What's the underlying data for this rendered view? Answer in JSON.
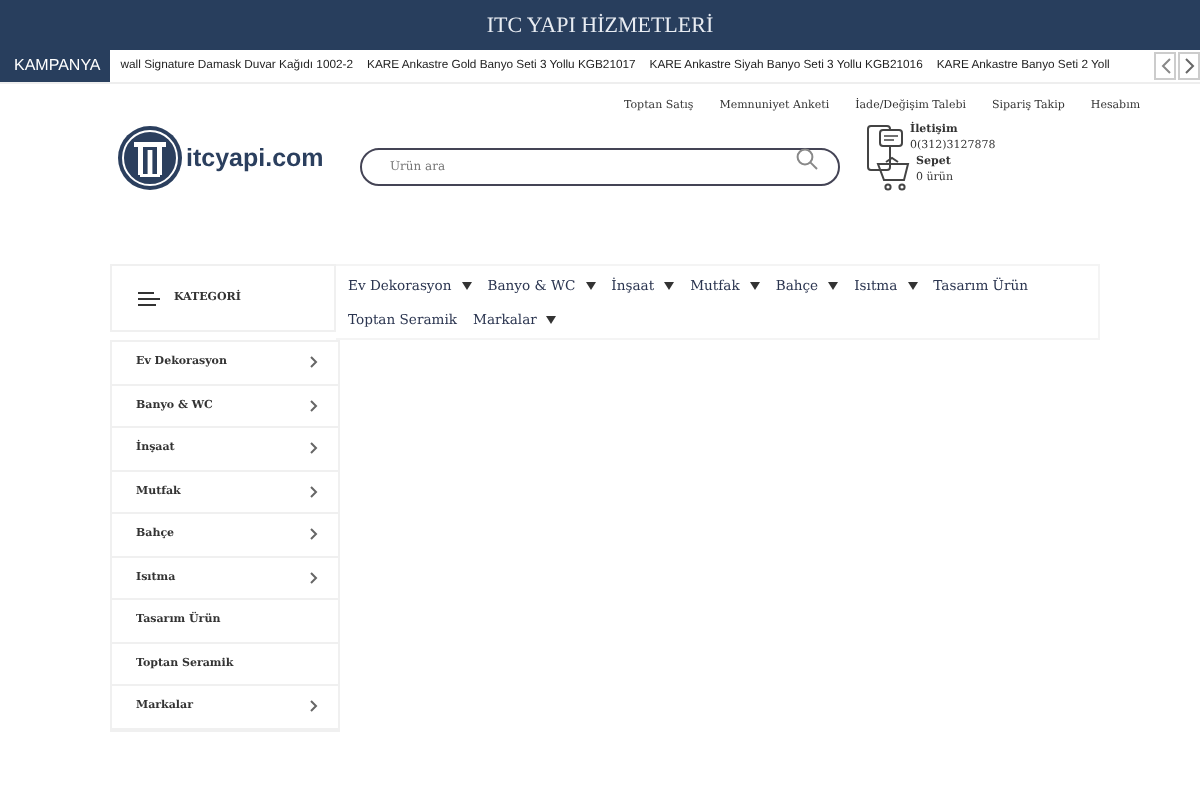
{
  "top_banner": {
    "title": "ITC YAPI HİZMETLERİ"
  },
  "campaign": {
    "label": "KAMPANYA",
    "items": [
      "wall Signature Damask Duvar Kağıdı 1002-2",
      "KARE Ankastre Gold Banyo Seti 3 Yollu KGB21017",
      "KARE Ankastre Siyah Banyo Seti 3 Yollu KGB21016",
      "KARE Ankastre Banyo Seti 2 Yoll"
    ]
  },
  "top_links": [
    "Toptan Satış",
    "Memnuniyet Anketi",
    "İade/Değişim Talebi",
    "Sipariş Takip",
    "Hesabım"
  ],
  "logo": {
    "text": "itcyapi.com"
  },
  "search": {
    "placeholder": "Ürün ara"
  },
  "contact": {
    "label": "İletişim",
    "phone": "0(312)3127878"
  },
  "cart": {
    "label": "Sepet",
    "count": "0 ürün"
  },
  "category_button": {
    "label": "KATEGORİ"
  },
  "nav": [
    {
      "label": "Ev Dekorasyon",
      "has_dropdown": true
    },
    {
      "label": "Banyo & WC",
      "has_dropdown": true
    },
    {
      "label": "İnşaat",
      "has_dropdown": true
    },
    {
      "label": "Mutfak",
      "has_dropdown": true
    },
    {
      "label": "Bahçe",
      "has_dropdown": true
    },
    {
      "label": "Isıtma",
      "has_dropdown": true
    },
    {
      "label": "Tasarım Ürün",
      "has_dropdown": false
    },
    {
      "label": "Toptan Seramik",
      "has_dropdown": false
    },
    {
      "label": "Markalar",
      "has_dropdown": true
    }
  ],
  "sidebar": {
    "items": [
      {
        "label": "Ev Dekorasyon",
        "has_arrow": true
      },
      {
        "label": "Banyo & WC",
        "has_arrow": true
      },
      {
        "label": "İnşaat",
        "has_arrow": true
      },
      {
        "label": "Mutfak",
        "has_arrow": true
      },
      {
        "label": "Bahçe",
        "has_arrow": true
      },
      {
        "label": "Isıtma",
        "has_arrow": true
      },
      {
        "label": "Tasarım Ürün",
        "has_arrow": false
      },
      {
        "label": "Toptan Seramik",
        "has_arrow": false
      },
      {
        "label": "Markalar",
        "has_arrow": true
      }
    ]
  }
}
